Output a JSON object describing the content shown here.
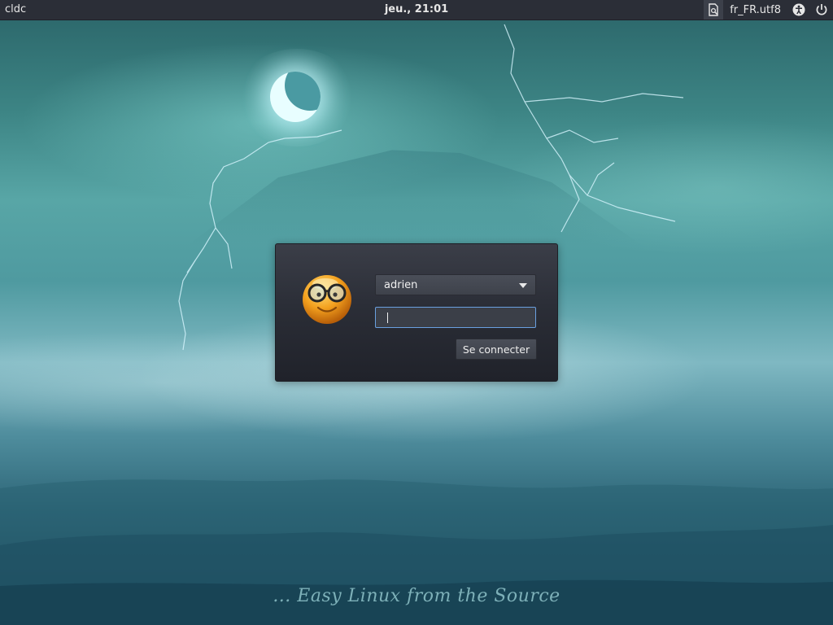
{
  "top_bar": {
    "hostname": "cldc",
    "clock": "jeu., 21:01",
    "locale": "fr_FR.utf8",
    "icons": {
      "keyboard": "keyboard-layout-icon",
      "accessibility": "accessibility-icon",
      "power": "power-icon"
    }
  },
  "login": {
    "avatar": "smiley-glasses-avatar",
    "selected_user": "adrien",
    "password_value": "",
    "login_button_label": "Se connecter"
  },
  "background": {
    "tagline": "... Easy Linux from the Source"
  },
  "colors": {
    "panel": "#2b2e37",
    "focus_border": "#6aa0e0",
    "login_box": "#2b2e37"
  }
}
